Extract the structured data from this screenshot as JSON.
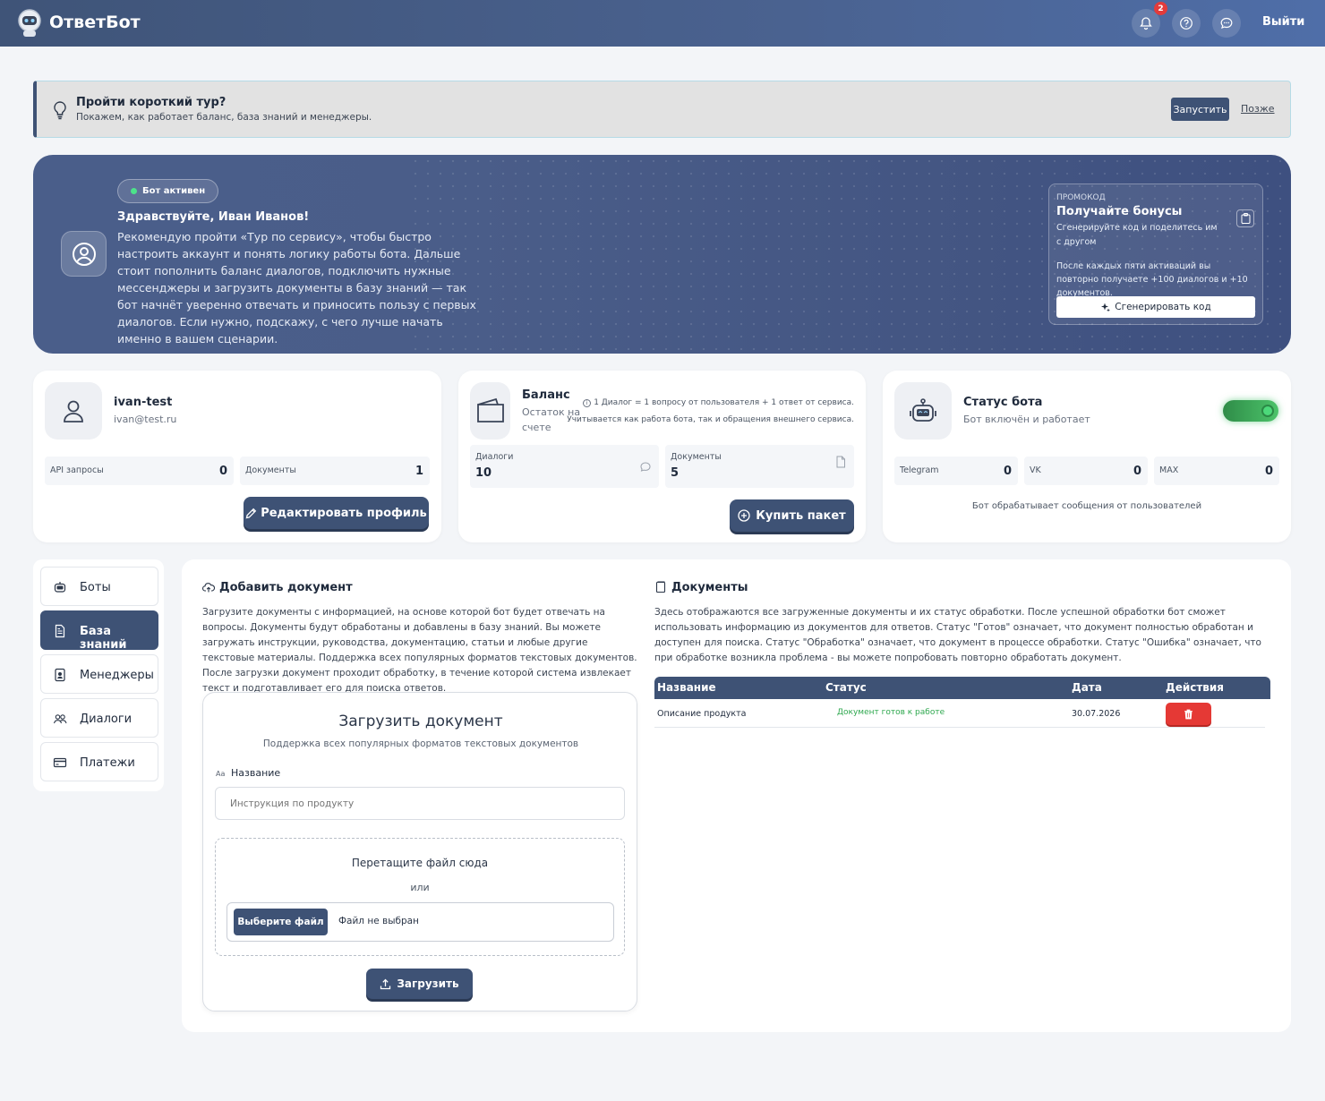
{
  "header": {
    "brand": "ОтветБот",
    "notifications_count": "2",
    "logout_label": "Выйти",
    "icons": [
      "robot-logo-icon",
      "bell-icon",
      "help-icon",
      "chat-icon"
    ]
  },
  "tour": {
    "title": "Пройти короткий тур?",
    "subtitle": "Покажем, как работает баланс, база знаний и менеджеры.",
    "start_label": "Запустить",
    "later_label": "Позже"
  },
  "hero": {
    "status_pill": "Бот активен",
    "greeting": "Здравствуйте, Иван Иванов!",
    "message": "Рекомендую пройти «Тур по сервису», чтобы быстро настроить аккаунт и понять логику работы бота. Дальше стоит пополнить баланс диалогов, подключить нужные мессенджеры и загрузить документы в базу знаний — так бот начнёт уверенно отвечать и приносить пользу с первых диалогов. Если нужно, подскажу, с чего лучше начать именно в вашем сценарии.",
    "promo": {
      "tag": "ПРОМОКОД",
      "title": "Получайте бонусы",
      "subtitle": "Сгенерируйте код и поделитесь им с другом",
      "note": "После каждых пяти активаций вы повторно получаете +100 диалогов и +10 документов.",
      "button_label": "Сгенерировать код"
    }
  },
  "profile": {
    "username": "ivan-test",
    "email": "ivan@test.ru",
    "stats": [
      {
        "label": "API запросы",
        "value": "0"
      },
      {
        "label": "Документы",
        "value": "1"
      }
    ],
    "edit_label": "Редактировать профиль"
  },
  "balance": {
    "title": "Баланс",
    "subtitle": "Остаток на счете",
    "note1": "1 Диалог = 1 вопросу от пользователя + 1 ответ от сервиса.",
    "note2": "Учитывается как работа бота, так и обращения внешнего сервиса.",
    "stats": [
      {
        "label": "Диалоги",
        "value": "10"
      },
      {
        "label": "Документы",
        "value": "5"
      }
    ],
    "buy_label": "Купить пакет"
  },
  "bot_status": {
    "title": "Статус бота",
    "subtitle": "Бот включён и работает",
    "enabled": true,
    "channels": [
      {
        "label": "Telegram",
        "value": "0"
      },
      {
        "label": "VK",
        "value": "0"
      },
      {
        "label": "MAX",
        "value": "0"
      }
    ],
    "footer": "Бот обрабатывает сообщения от пользователей"
  },
  "sidebar": {
    "items": [
      {
        "label": "Боты",
        "icon": "robot-icon",
        "active": false
      },
      {
        "label": "База знаний",
        "icon": "document-icon",
        "active": true
      },
      {
        "label": "Менеджеры",
        "icon": "id-badge-icon",
        "active": false
      },
      {
        "label": "Диалоги",
        "icon": "users-icon",
        "active": false
      },
      {
        "label": "Платежи",
        "icon": "credit-card-icon",
        "active": false
      }
    ]
  },
  "add_document": {
    "title": "Добавить документ",
    "description": "Загрузите документы с информацией, на основе которой бот будет отвечать на вопросы. Документы будут обработаны и добавлены в базу знаний. Вы можете загружать инструкции, руководства, документацию, статьи и любые другие текстовые материалы. Поддержка всех популярных форматов текстовых документов. После загрузки документ проходит обработку, в течение которой система извлекает текст и подготавливает его для поиска ответов.",
    "form": {
      "title": "Загрузить документ",
      "subtitle": "Поддержка всех популярных форматов текстовых документов",
      "name_icon_text": "Aa",
      "name_label": "Название",
      "name_placeholder": "Инструкция по продукту",
      "drop_text": "Перетащите файл сюда",
      "or_text": "или",
      "choose_file_label": "Выберите файл",
      "no_file_text": "Файл не выбран",
      "upload_label": "Загрузить"
    }
  },
  "documents": {
    "title": "Документы",
    "description": "Здесь отображаются все загруженные документы и их статус обработки. После успешной обработки бот сможет использовать информацию из документов для ответов. Статус \"Готов\" означает, что документ полностью обработан и доступен для поиска. Статус \"Обработка\" означает, что документ в процессе обработки. Статус \"Ошибка\" означает, что при обработке возникла проблема - вы можете попробовать повторно обработать документ.",
    "columns": [
      "Название",
      "Статус",
      "Дата",
      "Действия"
    ],
    "rows": [
      {
        "name": "Описание продукта",
        "status": "Документ готов к работе",
        "date": "30.07.2026"
      }
    ]
  },
  "colors": {
    "primary": "#3e5275",
    "success": "#2fa84f",
    "danger": "#e53935",
    "background": "#f3f5f8"
  }
}
